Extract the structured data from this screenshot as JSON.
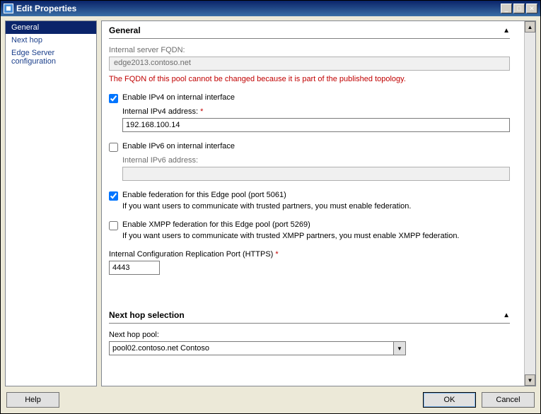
{
  "window": {
    "title": "Edit Properties"
  },
  "sidebar": {
    "items": [
      {
        "label": "General",
        "active": true
      },
      {
        "label": "Next hop",
        "active": false
      },
      {
        "label": "Edge Server configuration",
        "active": false
      }
    ]
  },
  "general": {
    "heading": "General",
    "fqdn_label": "Internal server FQDN:",
    "fqdn_value": "edge2013.contoso.net",
    "fqdn_warning": "The FQDN of this pool cannot be changed because it is part of the published topology.",
    "ipv4_enable_label": "Enable IPv4 on internal interface",
    "ipv4_addr_label": "Internal IPv4 address:",
    "ipv4_addr_value": "192.168.100.14",
    "ipv6_enable_label": "Enable IPv6 on internal interface",
    "ipv6_addr_label": "Internal IPv6 address:",
    "ipv6_addr_value": "",
    "fed_label": "Enable federation for this Edge pool (port 5061)",
    "fed_hint": "If you want users to communicate with trusted partners, you must enable federation.",
    "xmpp_label": "Enable XMPP federation for this Edge pool (port 5269)",
    "xmpp_hint": "If you want users to communicate with trusted XMPP partners, you must enable XMPP federation.",
    "repl_port_label": "Internal Configuration Replication Port (HTTPS)",
    "repl_port_value": "4443"
  },
  "nexthop": {
    "heading": "Next hop selection",
    "pool_label": "Next hop pool:",
    "pool_value": "pool02.contoso.net   Contoso"
  },
  "footer": {
    "help": "Help",
    "ok": "OK",
    "cancel": "Cancel"
  }
}
